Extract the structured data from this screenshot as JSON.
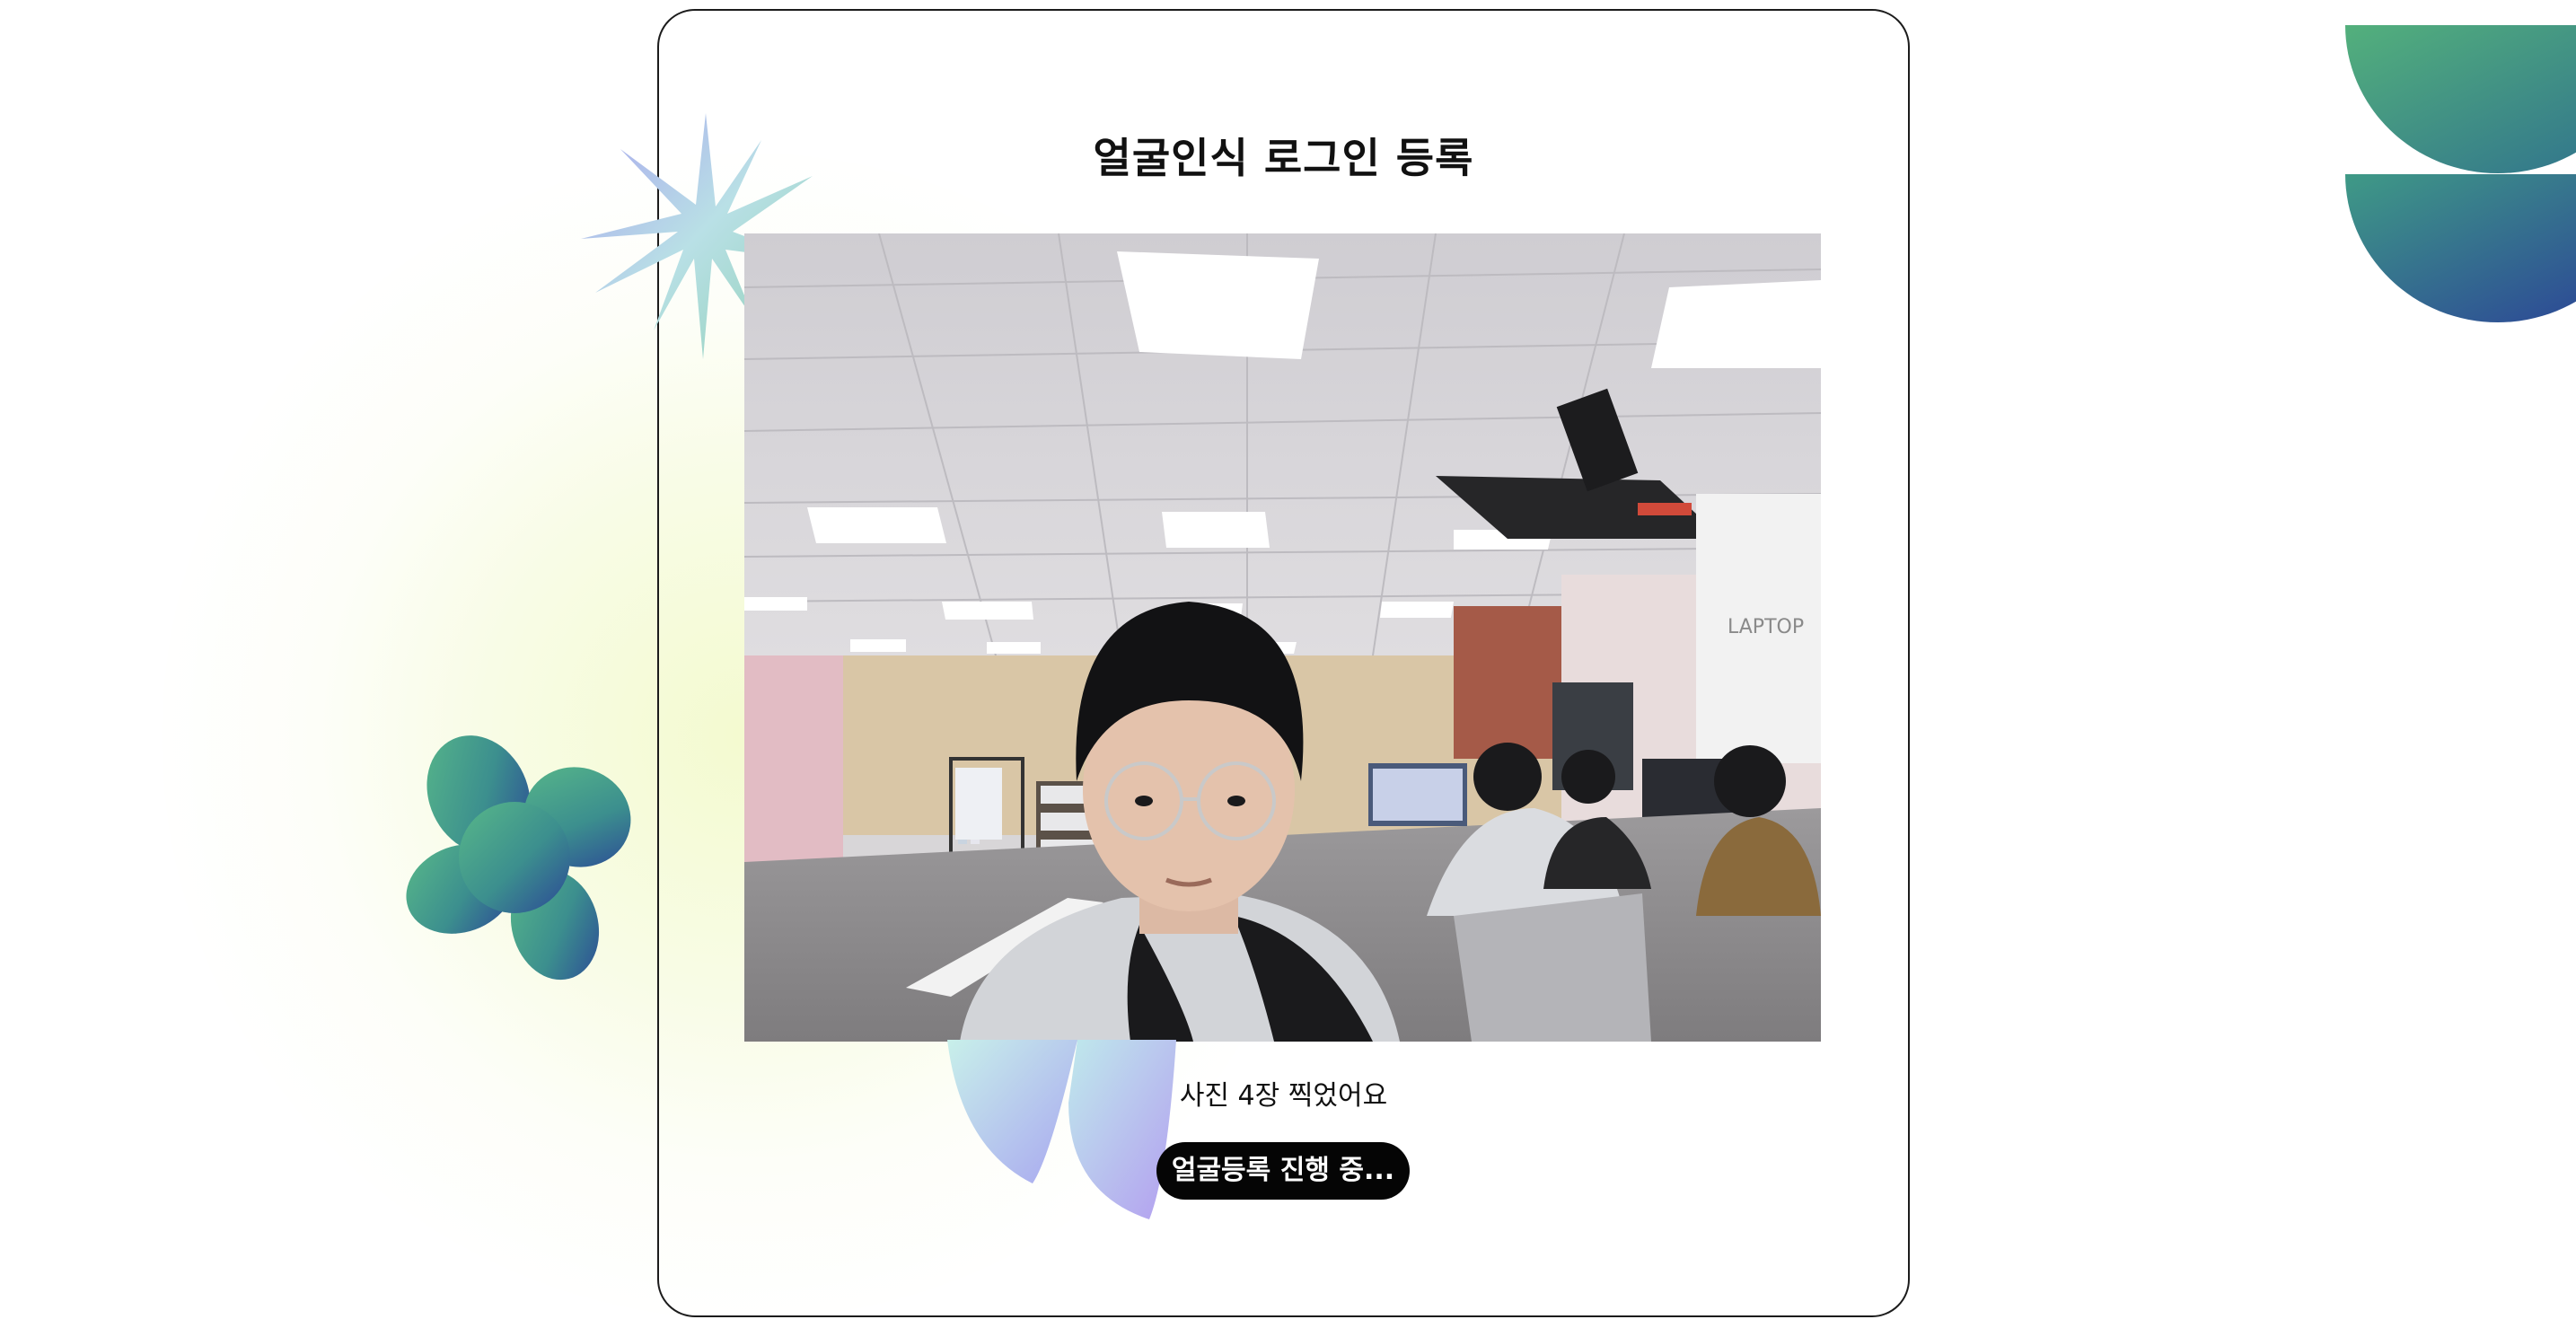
{
  "registration": {
    "title": "얼굴인식 로그인 등록",
    "status_text": "사진 4장 찍었어요",
    "progress_button_label": "얼굴등록 진행 중..."
  },
  "camera": {
    "signage_text": "LAPTOP"
  },
  "colors": {
    "card_border": "#1c1c1c",
    "button_bg": "#050505",
    "button_text": "#ffffff",
    "deco_green": "#4fae7e",
    "deco_blue": "#2b4c9b",
    "deco_lavender": "#b6b2f2"
  }
}
